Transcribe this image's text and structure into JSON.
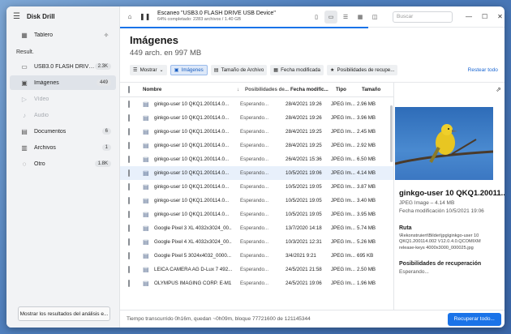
{
  "app": {
    "name": "Disk Drill"
  },
  "sidebar": {
    "tablero": "Tablero",
    "section": "Result.",
    "items": [
      {
        "label": "USB3.0 FLASH DRIVE USB ...",
        "count": "2.3K",
        "icon": "drive-icon"
      },
      {
        "label": "Imágenes",
        "count": "449",
        "icon": "image-icon"
      },
      {
        "label": "Vídeo",
        "count": "",
        "icon": "video-icon"
      },
      {
        "label": "Audio",
        "count": "",
        "icon": "audio-icon"
      },
      {
        "label": "Documentos",
        "count": "6",
        "icon": "document-icon"
      },
      {
        "label": "Archivos",
        "count": "1",
        "icon": "archive-icon"
      },
      {
        "label": "Otro",
        "count": "1.8K",
        "icon": "other-icon"
      }
    ],
    "bottom_button": "Mostrar los resultados del análisis e..."
  },
  "topbar": {
    "scan_title": "Escaneo \"USB3.0 FLASH DRIVE USB Device\"",
    "scan_sub": "64% completado: 2283 archivos / 1.40 GB",
    "progress_fraction": 0.64,
    "search_placeholder": "Buscar"
  },
  "header": {
    "title": "Imágenes",
    "subtitle": "449 arch. en 997 MB"
  },
  "filters": {
    "show": "Mostrar",
    "images": "Imágenes",
    "size": "Tamaño de Archivo",
    "modified": "Fecha modificada",
    "recovery": "Posibilidades de recupe...",
    "reset": "Restear todo"
  },
  "table": {
    "columns": {
      "name": "Nombre",
      "recovery": "Posibilidades de...",
      "date": "Fecha modific...",
      "type": "Tipo",
      "size": "Tamaño"
    },
    "rows": [
      {
        "name": "ginkgo-user 10 QKQ1.200114.0...",
        "recovery": "Esperando...",
        "date": "28/4/2021 19:26",
        "type": "JPEG Im...",
        "size": "2.96 MB",
        "selected": false
      },
      {
        "name": "ginkgo-user 10 QKQ1.200114.0...",
        "recovery": "Esperando...",
        "date": "28/4/2021 19:26",
        "type": "JPEG Im...",
        "size": "3.96 MB",
        "selected": false
      },
      {
        "name": "ginkgo-user 10 QKQ1.200114.0...",
        "recovery": "Esperando...",
        "date": "28/4/2021 19:25",
        "type": "JPEG Im...",
        "size": "2.45 MB",
        "selected": false
      },
      {
        "name": "ginkgo-user 10 QKQ1.200114.0...",
        "recovery": "Esperando...",
        "date": "28/4/2021 19:25",
        "type": "JPEG Im...",
        "size": "2.92 MB",
        "selected": false
      },
      {
        "name": "ginkgo-user 10 QKQ1.200114.0...",
        "recovery": "Esperando...",
        "date": "26/4/2021 15:36",
        "type": "JPEG Im...",
        "size": "6.50 MB",
        "selected": false
      },
      {
        "name": "ginkgo-user 10 QKQ1.200114.0...",
        "recovery": "Esperando...",
        "date": "10/5/2021 19:06",
        "type": "JPEG Im...",
        "size": "4.14 MB",
        "selected": true
      },
      {
        "name": "ginkgo-user 10 QKQ1.200114.0...",
        "recovery": "Esperando...",
        "date": "10/5/2021 19:05",
        "type": "JPEG Im...",
        "size": "3.87 MB",
        "selected": false
      },
      {
        "name": "ginkgo-user 10 QKQ1.200114.0...",
        "recovery": "Esperando...",
        "date": "10/5/2021 19:05",
        "type": "JPEG Im...",
        "size": "3.40 MB",
        "selected": false
      },
      {
        "name": "ginkgo-user 10 QKQ1.200114.0...",
        "recovery": "Esperando...",
        "date": "10/5/2021 19:05",
        "type": "JPEG Im...",
        "size": "3.95 MB",
        "selected": false
      },
      {
        "name": "Google Pixel 3 XL 4032x3024_00...",
        "recovery": "Esperando...",
        "date": "13/7/2020 14:18",
        "type": "JPEG Im...",
        "size": "5.74 MB",
        "selected": false
      },
      {
        "name": "Google Pixel 4 XL 4032x3024_00...",
        "recovery": "Esperando...",
        "date": "10/3/2021 12:31",
        "type": "JPEG Im...",
        "size": "5.26 MB",
        "selected": false
      },
      {
        "name": "Google Pixel 5 3024x4032_0000...",
        "recovery": "Esperando...",
        "date": "3/4/2021 9:21",
        "type": "JPEG Im...",
        "size": "695 KB",
        "selected": false
      },
      {
        "name": "LEICA CAMERA AG D-Lux 7 492...",
        "recovery": "Esperando...",
        "date": "24/5/2021 21:58",
        "type": "JPEG Im...",
        "size": "2.50 MB",
        "selected": false
      },
      {
        "name": "OLYMPUS IMAGING CORP. E-M1...",
        "recovery": "Esperando...",
        "date": "24/5/2021 19:06",
        "type": "JPEG Im...",
        "size": "1.96 MB",
        "selected": false
      }
    ]
  },
  "preview": {
    "title": "ginkgo-user 10 QKQ1.20011...",
    "type": "JPEG Image – 4.14 MB",
    "date": "Fecha modificación 10/5/2021 19:06",
    "path_label": "Ruta",
    "path": "\\Rekonstruiert\\Bilder\\jpg\\ginkgo-user 10 QKQ1.200114.002 V12.0.4.0.QCOMIXM release-keys 4000x3000_000025.jpg",
    "recovery_label": "Posibilidades de recuperación",
    "recovery": "Esperando..."
  },
  "status": {
    "text": "Tiempo transcurrido 0h16m, quedan ~0h09m, bloque 77721600 de 121145344",
    "recover_button": "Recuperar todo..."
  }
}
